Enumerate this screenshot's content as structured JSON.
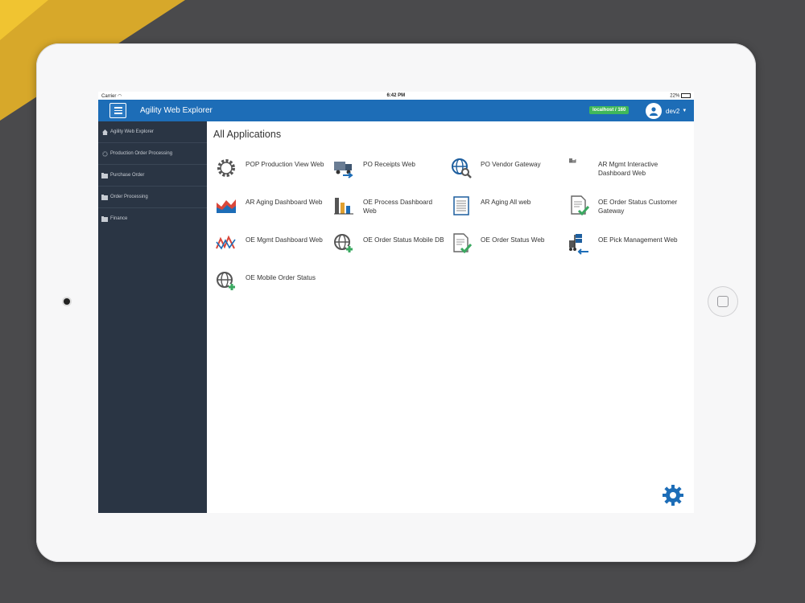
{
  "statusbar": {
    "carrier": "Carrier",
    "time": "6:42 PM",
    "battery": "22%"
  },
  "header": {
    "title": "Agility Web Explorer",
    "host": "localhost / 160",
    "user": "dev2"
  },
  "sidebar": {
    "items": [
      {
        "label": "Agility Web Explorer",
        "icon": "home-icon"
      },
      {
        "label": "Production Order Processing",
        "icon": "gear-icon"
      },
      {
        "label": "Purchase Order",
        "icon": "folder-icon"
      },
      {
        "label": "Order Processing",
        "icon": "folder-icon"
      },
      {
        "label": "Finance",
        "icon": "folder-icon"
      }
    ]
  },
  "main": {
    "heading": "All Applications",
    "apps": [
      {
        "label": "POP Production View Web",
        "icon": "gear-icon"
      },
      {
        "label": "PO Receipts Web",
        "icon": "truck-icon"
      },
      {
        "label": "PO Vendor Gateway",
        "icon": "globe-search-icon"
      },
      {
        "label": "AR Mgmt Interactive Dashboard Web",
        "icon": "small-chart-icon"
      },
      {
        "label": "AR Aging Dashboard Web",
        "icon": "area-chart-icon"
      },
      {
        "label": "OE Process Dashboard Web",
        "icon": "bar-chart-icon"
      },
      {
        "label": "AR Aging All web",
        "icon": "list-document-icon"
      },
      {
        "label": "OE Order Status Customer Gateway",
        "icon": "document-check-icon"
      },
      {
        "label": "OE Mgmt Dashboard Web",
        "icon": "line-chart-icon"
      },
      {
        "label": "OE Order Status Mobile DB",
        "icon": "globe-plus-icon"
      },
      {
        "label": "OE Order Status Web",
        "icon": "document-check-icon"
      },
      {
        "label": "OE Pick Management Web",
        "icon": "forklift-icon"
      },
      {
        "label": "OE Mobile Order Status",
        "icon": "globe-plus-icon"
      }
    ]
  },
  "colors": {
    "header": "#1d6db7",
    "sidebar": "#2a3544",
    "badge": "#40b85a",
    "gear_fab": "#1d6db7"
  }
}
